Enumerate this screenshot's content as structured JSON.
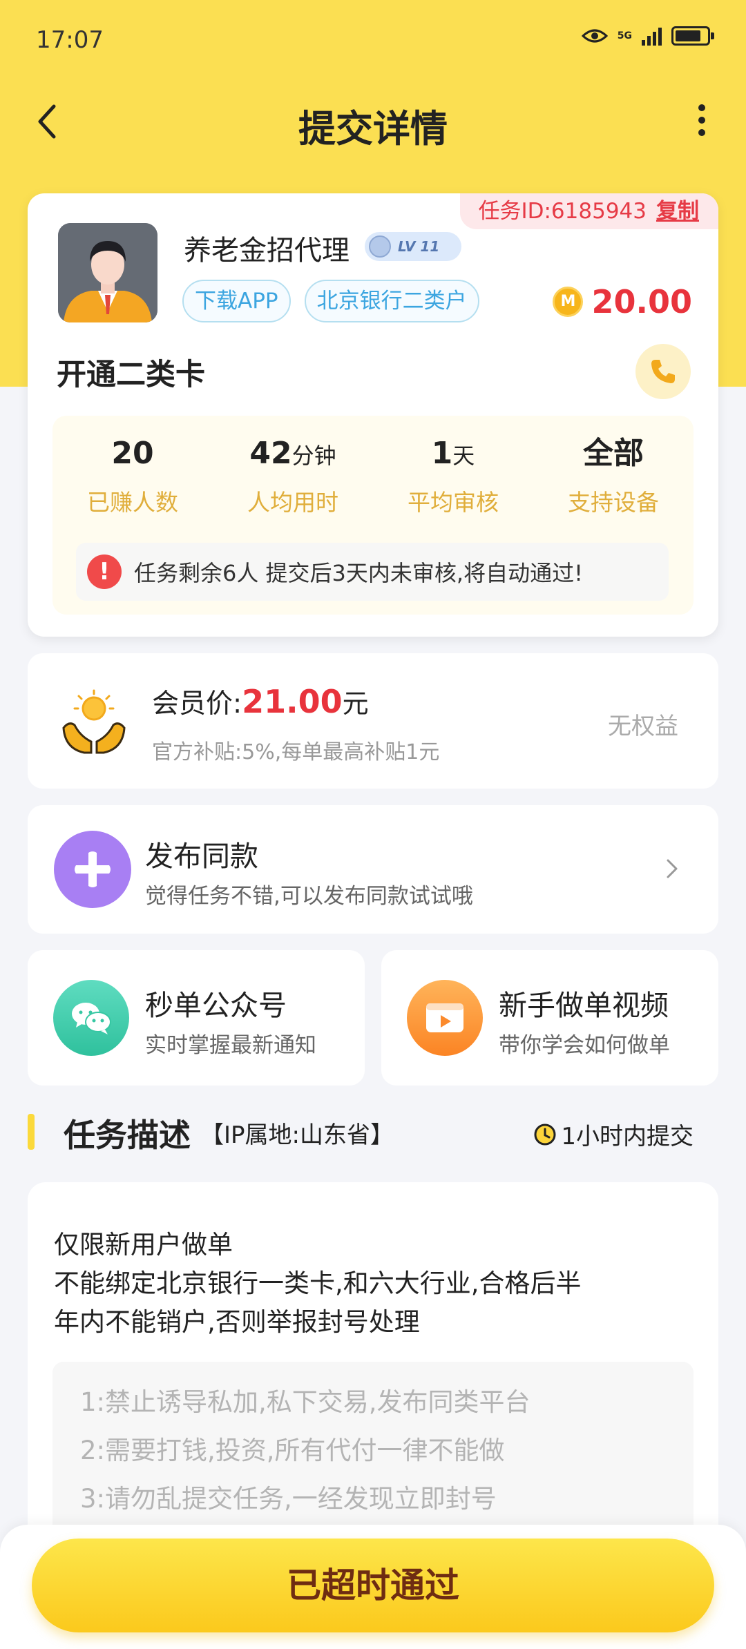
{
  "status_bar": {
    "time": "17:07",
    "network": "5G"
  },
  "header": {
    "title": "提交详情"
  },
  "task": {
    "id_label": "任务ID:6185943",
    "copy_label": "复制",
    "publisher_name": "养老金招代理",
    "level": "LV 11",
    "tags": [
      "下载APP",
      "北京银行二类户"
    ],
    "reward": "20.00",
    "coin_symbol": "M",
    "title": "开通二类卡",
    "stats": [
      {
        "value": "20",
        "unit": "",
        "label": "已赚人数"
      },
      {
        "value": "42",
        "unit": "分钟",
        "label": "人均用时"
      },
      {
        "value": "1",
        "unit": "天",
        "label": "平均审核"
      },
      {
        "value": "全部",
        "unit": "",
        "label": "支持设备"
      }
    ],
    "notice_mark": "!",
    "notice": "任务剩余6人  提交后3天内未审核,将自动通过!"
  },
  "member": {
    "label": "会员价:",
    "price": "21.00",
    "unit": "元",
    "subsidy": "官方补贴:5%,每单最高补贴1元",
    "status": "无权益"
  },
  "publish": {
    "title": "发布同款",
    "subtitle": "觉得任务不错,可以发布同款试试哦"
  },
  "shortcuts": [
    {
      "title": "秒单公众号",
      "subtitle": "实时掌握最新通知"
    },
    {
      "title": "新手做单视频",
      "subtitle": "带你学会如何做单"
    }
  ],
  "description": {
    "title": "任务描述",
    "ip": "【IP属地:山东省】",
    "time_limit": "1小时内提交",
    "lines": [
      "仅限新用户做单",
      "不能绑定北京银行一类卡,和六大行业,合格后半",
      "年内不能销户,否则举报封号处理"
    ],
    "rules": [
      "1:禁止诱导私加,私下交易,发布同类平台",
      "2:需要打钱,投资,所有代付一律不能做",
      "3:请勿乱提交任务,一经发现立即封号"
    ]
  },
  "bottom": {
    "button_label": "已超时通过"
  },
  "colors": {
    "header_bg": "#fbdf52",
    "price_red": "#e8333c",
    "tag_blue": "#3ca5e0",
    "stat_label": "#e0ae3b",
    "button_text": "#6e2c12"
  },
  "icons": {
    "back": "chevron-left-icon",
    "more": "more-vertical-icon",
    "phone": "phone-icon",
    "publish": "plus-icon",
    "wechat": "wechat-icon",
    "video": "video-icon",
    "clock": "clock-icon"
  }
}
